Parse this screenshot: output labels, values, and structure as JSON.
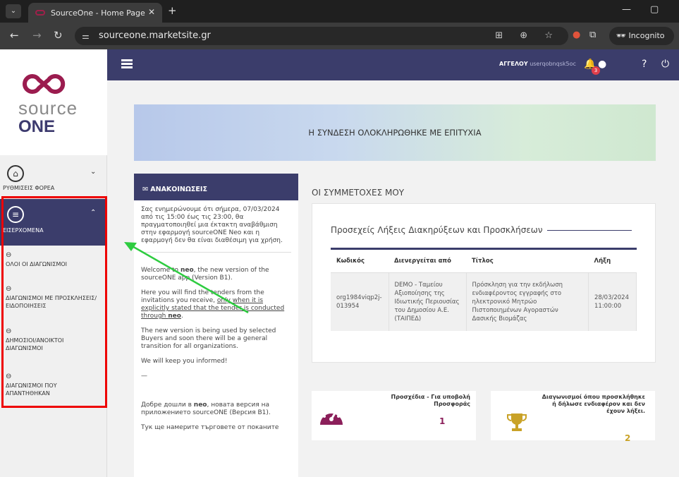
{
  "browser": {
    "tab_title": "SourceOne - Home Page",
    "url": "sourceone.marketsite.gr",
    "incognito_label": "Incognito"
  },
  "logo": {
    "word1": "source",
    "word2": "ONE"
  },
  "sidebar": {
    "settings_label": "ΡΥΘΜΙΣΕΙΣ ΦΟΡΕΑ",
    "inbox_label": "ΕΙΣΕΡΧΟΜΕΝΑ",
    "items": [
      {
        "label": "ΟΛΟΙ ΟΙ ΔΙΑΓΩΝΙΣΜΟΙ"
      },
      {
        "label": "ΔΙΑΓΩΝΙΣΜΟΙ ΜΕ ΠΡΟΣΚΛΗΣΕΙΣ/ΕΙΔΟΠΟΙΗΣΕΙΣ"
      },
      {
        "label": "ΔΗΜΟΣΙΟΙ/ΑΝΟΙΚΤΟΙ ΔΙΑΓΩΝΙΣΜΟΙ"
      },
      {
        "label": "ΔΙΑΓΩΝΙΣΜΟΙ ΠΟΥ ΑΠΑΝΤΗΘΗΚΑΝ"
      }
    ]
  },
  "topbar": {
    "user_prefix": "ΑΓΓΕΛΟΥ",
    "username": "userqobnqsk5oc",
    "notifications": "3"
  },
  "banner": {
    "text": "Η ΣΥΝΔΕΣΗ ΟΛΟΚΛΗΡΩΘΗΚΕ ΜΕ ΕΠΙΤΥΧΙΑ"
  },
  "announcements": {
    "title": "ΑΝΑΚΟΙΝΩΣΕΙΣ",
    "p1": "Σας ενημερώνουμε ότι σήμερα, 07/03/2024 από τις 15:00 έως τις 23:00, θα πραγματοποιηθεί μια έκτακτη αναβάθμιση στην εφαρμογή sourceONE Neo και η εφαρμογή δεν θα είναι διαθέσιμη για χρήση.",
    "p2_a": "Welcome to ",
    "p2_b": "neo",
    "p2_c": ", the new version of the sourceONE app (Version B1).",
    "p3_a": "Here you will find the tenders from the invitations you receive, ",
    "p3_b": "only when it is explicitly stated that the tender is conducted through ",
    "p3_c": "neo",
    "p4": "The new version is being used by selected Buyers and soon there will be a general transition for all organizations.",
    "p5": "We will keep you informed!",
    "p6": "—",
    "p7_a": "Добре дошли в ",
    "p7_b": "neo",
    "p7_c": ", новата версия на приложението sourceONE (Версия B1).",
    "p8": "Тук ще намерите търговете от поканите"
  },
  "participations": {
    "title": "ΟΙ ΣΥΜΜΕΤΟΧΕΣ ΜΟΥ"
  },
  "deadlines": {
    "title": "Προσεχείς Λήξεις Διακηρύξεων και Προσκλήσεων",
    "headers": [
      "Κωδικός",
      "Διενεργείται από",
      "Τίτλος",
      "Λήξη"
    ],
    "row": [
      "org1984viqp2j-013954",
      "DEMO - Ταμείου Αξιοποίησης της Ιδιωτικής Περιουσίας του Δημοσίου Α.Ε. (ΤΑΙΠΕΔ)",
      "Πρόσκληση για την εκδήλωση ενδιαφέροντος εγγραφής στο ηλεκτρονικό Μητρώο Πιστοποιημένων Αγοραστών Δασικής Βιομάζας",
      "28/03/2024 11:00:00"
    ]
  },
  "stats": [
    {
      "label": "Προσχέδια - Για υποβολή Προσφοράς",
      "value": "1",
      "color": "#8b1f5a"
    },
    {
      "label": "Διαγωνισμοί όπου προσκλήθηκε ή δήλωσε ενδιαφέρον και δεν έχουν λήξει.",
      "value": "2",
      "color": "#c9a227"
    }
  ]
}
